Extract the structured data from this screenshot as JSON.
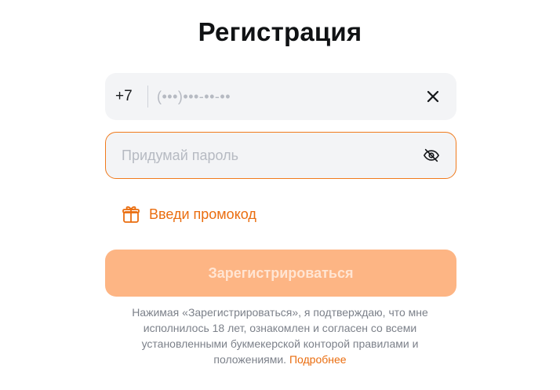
{
  "page": {
    "title": "Регистрация"
  },
  "phone": {
    "country_code": "+7",
    "placeholder": "(•••)•••-••-••",
    "clear_icon": "close-icon"
  },
  "password": {
    "placeholder": "Придумай пароль",
    "toggle_icon": "eye-off-icon"
  },
  "promo": {
    "label": "Введи промокод",
    "icon": "gift-icon"
  },
  "submit": {
    "label": "Зарегистрироваться"
  },
  "disclaimer": {
    "text": "Нажимая «Зарегистрироваться», я подтверждаю, что мне исполнилось 18 лет, ознакомлен и согласен со всеми установленными букмекерской конторой правилами и положениями.",
    "link_label": "Подробнее"
  },
  "colors": {
    "accent": "#ea6d0f",
    "field_background": "#f3f4f6",
    "focus_border": "#f07a1c",
    "button_disabled": "#fdb584",
    "text_primary": "#101214",
    "text_muted": "#7c818a"
  }
}
